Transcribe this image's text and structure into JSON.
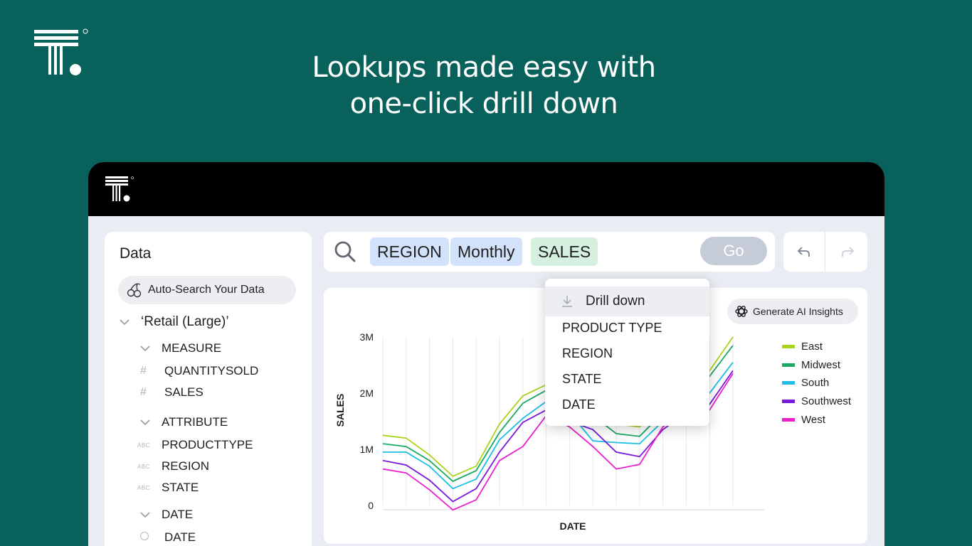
{
  "headline": {
    "line1": "Lookups made easy with",
    "line2": "one-click drill down"
  },
  "data_panel": {
    "title": "Data",
    "auto_search_label": "Auto-Search Your Data",
    "source_name": "‘Retail (Large)’",
    "groups": [
      {
        "label": "MEASURE",
        "items": [
          {
            "glyph": "#",
            "label": "QUANTITYSOLD"
          },
          {
            "glyph": "#",
            "label": "SALES"
          }
        ]
      },
      {
        "label": "ATTRIBUTE",
        "items": [
          {
            "glyph": "ABC",
            "label": "PRODUCTTYPE"
          },
          {
            "glyph": "ABC",
            "label": "REGION"
          },
          {
            "glyph": "ABC",
            "label": "STATE"
          }
        ]
      },
      {
        "label": "DATE",
        "items": [
          {
            "glyph": "circle",
            "label": "DATE"
          }
        ]
      }
    ]
  },
  "search": {
    "tokens": [
      "REGION",
      "Monthly",
      "SALES"
    ],
    "go_label": "Go"
  },
  "ai_button_label": "Generate AI Insights",
  "dropdown": {
    "drill_label": "Drill down",
    "items": [
      "PRODUCT TYPE",
      "REGION",
      "STATE",
      "DATE"
    ]
  },
  "colors": {
    "background": "#08615a",
    "East": "#a8d41c",
    "Midwest": "#1ba862",
    "South": "#1dbde6",
    "Southwest": "#7a18dc",
    "West": "#ec1fcf"
  },
  "chart_data": {
    "type": "line",
    "xlabel": "DATE",
    "ylabel": "SALES",
    "y_tick_labels": [
      "0",
      "1M",
      "2M",
      "3M"
    ],
    "ylim": [
      0,
      3000000
    ],
    "grid": "vertical",
    "legend_position": "right",
    "x": [
      1,
      2,
      3,
      4,
      5,
      6,
      7,
      8,
      9,
      10,
      11,
      12,
      13,
      14,
      15,
      16
    ],
    "series": [
      {
        "name": "East",
        "values": [
          1250000,
          1200000,
          900000,
          520000,
          700000,
          1450000,
          1950000,
          2150000,
          2000000,
          1750000,
          1450000,
          1400000,
          1750000,
          2000000,
          2400000,
          3000000
        ]
      },
      {
        "name": "Midwest",
        "values": [
          1100000,
          1050000,
          800000,
          430000,
          620000,
          1300000,
          1820000,
          2050000,
          1900000,
          1600000,
          1280000,
          1230000,
          1650000,
          1950000,
          2300000,
          2850000
        ]
      },
      {
        "name": "South",
        "values": [
          950000,
          950000,
          700000,
          300000,
          470000,
          1170000,
          1550000,
          1850000,
          1650000,
          1150000,
          1120000,
          1100000,
          1500000,
          1800000,
          2000000,
          2550000
        ]
      },
      {
        "name": "Southwest",
        "values": [
          800000,
          720000,
          450000,
          70000,
          300000,
          950000,
          1480000,
          1700000,
          1500000,
          1350000,
          950000,
          870000,
          1350000,
          1650000,
          1800000,
          2400000
        ]
      },
      {
        "name": "West",
        "values": [
          650000,
          580000,
          280000,
          -80000,
          100000,
          800000,
          1050000,
          1600000,
          1400000,
          1050000,
          650000,
          730000,
          1400000,
          1700000,
          1700000,
          2350000
        ]
      }
    ]
  }
}
